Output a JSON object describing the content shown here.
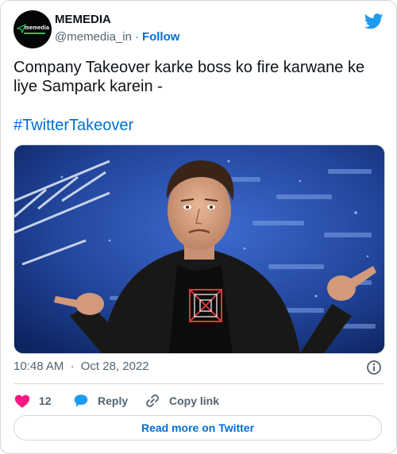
{
  "author": {
    "name": "MEMEDIA",
    "handle": "@memedia_in",
    "separator": "·",
    "follow_label": "Follow",
    "avatar_text": "memedia"
  },
  "tweet": {
    "text": "Company Takeover karke boss ko fire karwane ke liye Sampark karein -",
    "hashtag": "#TwitterTakeover",
    "time": "10:48 AM",
    "date_separator": "·",
    "date": "Oct 28, 2022"
  },
  "actions": {
    "like_count": "12",
    "reply_label": "Reply",
    "copy_link_label": "Copy link"
  },
  "footer": {
    "read_more_label": "Read more on Twitter"
  },
  "icons": {
    "brand": "twitter-bird-icon",
    "like": "heart-icon",
    "reply": "speech-bubble-icon",
    "copy": "link-icon",
    "info": "info-icon"
  },
  "colors": {
    "brand_blue": "#1d9bf0",
    "link_blue": "#006fd6",
    "heart_red": "#f91880",
    "muted": "#536471",
    "border": "#cfd9de"
  }
}
